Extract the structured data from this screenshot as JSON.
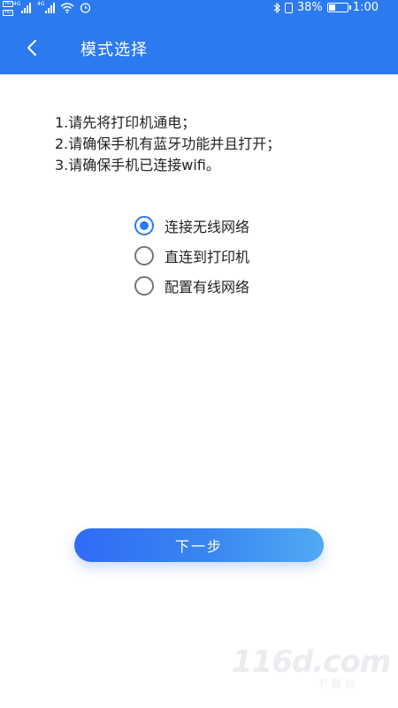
{
  "status_bar": {
    "sim1_label": "HD",
    "sim2_label": "HD",
    "network1": "4G",
    "network2": "4G",
    "battery_percent": "38%",
    "battery_level": 0.38,
    "time": "1:00"
  },
  "header": {
    "title": "模式选择",
    "back_icon": "chevron-left-icon",
    "color": "#2b7af0"
  },
  "instructions": [
    "1.请先将打印机通电；",
    "2.请确保手机有蓝牙功能并且打开；",
    "3.请确保手机已连接wifi。"
  ],
  "options": [
    {
      "label": "连接无线网络",
      "selected": true
    },
    {
      "label": "直连到打印机",
      "selected": false
    },
    {
      "label": "配置有线网络",
      "selected": false
    }
  ],
  "next_button": {
    "label": "下一步"
  },
  "watermark": {
    "logo": "116d.com",
    "site": "下载站"
  }
}
